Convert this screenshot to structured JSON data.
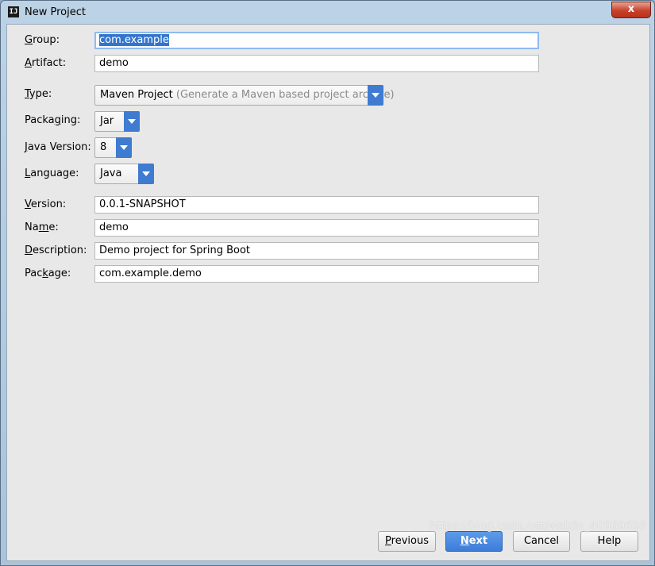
{
  "window": {
    "title": "New Project",
    "close_label": "x",
    "app_icon_text": "IJ"
  },
  "form": {
    "group": {
      "label_ul": "G",
      "label_rest": "roup:",
      "value": "com.example"
    },
    "artifact": {
      "label_ul": "A",
      "label_rest": "rtifact:",
      "value": "demo"
    },
    "type": {
      "label_ul": "T",
      "label_rest": "ype:",
      "value": "Maven Project",
      "hint": "(Generate a Maven based project archive)"
    },
    "packaging": {
      "label_pre": "Packa",
      "label_ul": "g",
      "label_rest": "ing:",
      "value": "Jar"
    },
    "java_version": {
      "label_ul": "J",
      "label_rest": "ava Version:",
      "value": "8"
    },
    "language": {
      "label_ul": "L",
      "label_rest": "anguage:",
      "value": "Java"
    },
    "version": {
      "label_ul": "V",
      "label_rest": "ersion:",
      "value": "0.0.1-SNAPSHOT"
    },
    "name": {
      "label_pre": "Na",
      "label_ul": "m",
      "label_rest": "e:",
      "value": "demo"
    },
    "description": {
      "label_ul": "D",
      "label_rest": "escription:",
      "value": "Demo project for Spring Boot"
    },
    "package": {
      "label_pre": "Pac",
      "label_ul": "k",
      "label_rest": "age:",
      "value": "com.example.demo"
    }
  },
  "buttons": {
    "previous": {
      "ul": "P",
      "rest": "revious"
    },
    "next": {
      "ul": "N",
      "rest": "ext"
    },
    "cancel": {
      "label": "Cancel"
    },
    "help": {
      "label": "Help"
    }
  },
  "watermark": "https://blog.csdn.net/weixin_40969698",
  "colors": {
    "accent": "#3e7bd1",
    "selection": "#3475cb",
    "client_bg": "#e8e8e8"
  }
}
